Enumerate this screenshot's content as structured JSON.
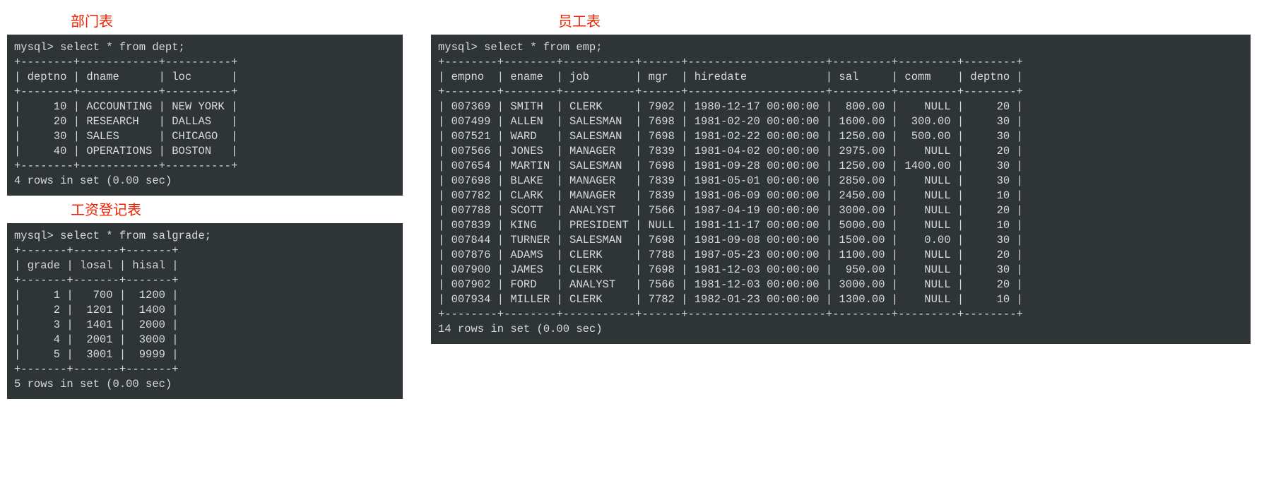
{
  "dept": {
    "caption": "部门表",
    "query": "mysql> select * from dept;",
    "headers": [
      "deptno",
      "dname",
      "loc"
    ],
    "rows": [
      {
        "deptno": "10",
        "dname": "ACCOUNTING",
        "loc": "NEW YORK"
      },
      {
        "deptno": "20",
        "dname": "RESEARCH",
        "loc": "DALLAS"
      },
      {
        "deptno": "30",
        "dname": "SALES",
        "loc": "CHICAGO"
      },
      {
        "deptno": "40",
        "dname": "OPERATIONS",
        "loc": "BOSTON"
      }
    ],
    "summary": "4 rows in set (0.00 sec)"
  },
  "salgrade": {
    "caption": "工资登记表",
    "query": "mysql> select * from salgrade;",
    "headers": [
      "grade",
      "losal",
      "hisal"
    ],
    "rows": [
      {
        "grade": "1",
        "losal": "700",
        "hisal": "1200"
      },
      {
        "grade": "2",
        "losal": "1201",
        "hisal": "1400"
      },
      {
        "grade": "3",
        "losal": "1401",
        "hisal": "2000"
      },
      {
        "grade": "4",
        "losal": "2001",
        "hisal": "3000"
      },
      {
        "grade": "5",
        "losal": "3001",
        "hisal": "9999"
      }
    ],
    "summary": "5 rows in set (0.00 sec)"
  },
  "emp": {
    "caption": "员工表",
    "query": "mysql> select * from emp;",
    "headers": [
      "empno",
      "ename",
      "job",
      "mgr",
      "hiredate",
      "sal",
      "comm",
      "deptno"
    ],
    "rows": [
      {
        "empno": "007369",
        "ename": "SMITH",
        "job": "CLERK",
        "mgr": "7902",
        "hiredate": "1980-12-17 00:00:00",
        "sal": "800.00",
        "comm": "NULL",
        "deptno": "20"
      },
      {
        "empno": "007499",
        "ename": "ALLEN",
        "job": "SALESMAN",
        "mgr": "7698",
        "hiredate": "1981-02-20 00:00:00",
        "sal": "1600.00",
        "comm": "300.00",
        "deptno": "30"
      },
      {
        "empno": "007521",
        "ename": "WARD",
        "job": "SALESMAN",
        "mgr": "7698",
        "hiredate": "1981-02-22 00:00:00",
        "sal": "1250.00",
        "comm": "500.00",
        "deptno": "30"
      },
      {
        "empno": "007566",
        "ename": "JONES",
        "job": "MANAGER",
        "mgr": "7839",
        "hiredate": "1981-04-02 00:00:00",
        "sal": "2975.00",
        "comm": "NULL",
        "deptno": "20"
      },
      {
        "empno": "007654",
        "ename": "MARTIN",
        "job": "SALESMAN",
        "mgr": "7698",
        "hiredate": "1981-09-28 00:00:00",
        "sal": "1250.00",
        "comm": "1400.00",
        "deptno": "30"
      },
      {
        "empno": "007698",
        "ename": "BLAKE",
        "job": "MANAGER",
        "mgr": "7839",
        "hiredate": "1981-05-01 00:00:00",
        "sal": "2850.00",
        "comm": "NULL",
        "deptno": "30"
      },
      {
        "empno": "007782",
        "ename": "CLARK",
        "job": "MANAGER",
        "mgr": "7839",
        "hiredate": "1981-06-09 00:00:00",
        "sal": "2450.00",
        "comm": "NULL",
        "deptno": "10"
      },
      {
        "empno": "007788",
        "ename": "SCOTT",
        "job": "ANALYST",
        "mgr": "7566",
        "hiredate": "1987-04-19 00:00:00",
        "sal": "3000.00",
        "comm": "NULL",
        "deptno": "20"
      },
      {
        "empno": "007839",
        "ename": "KING",
        "job": "PRESIDENT",
        "mgr": "NULL",
        "hiredate": "1981-11-17 00:00:00",
        "sal": "5000.00",
        "comm": "NULL",
        "deptno": "10"
      },
      {
        "empno": "007844",
        "ename": "TURNER",
        "job": "SALESMAN",
        "mgr": "7698",
        "hiredate": "1981-09-08 00:00:00",
        "sal": "1500.00",
        "comm": "0.00",
        "deptno": "30"
      },
      {
        "empno": "007876",
        "ename": "ADAMS",
        "job": "CLERK",
        "mgr": "7788",
        "hiredate": "1987-05-23 00:00:00",
        "sal": "1100.00",
        "comm": "NULL",
        "deptno": "20"
      },
      {
        "empno": "007900",
        "ename": "JAMES",
        "job": "CLERK",
        "mgr": "7698",
        "hiredate": "1981-12-03 00:00:00",
        "sal": "950.00",
        "comm": "NULL",
        "deptno": "30"
      },
      {
        "empno": "007902",
        "ename": "FORD",
        "job": "ANALYST",
        "mgr": "7566",
        "hiredate": "1981-12-03 00:00:00",
        "sal": "3000.00",
        "comm": "NULL",
        "deptno": "20"
      },
      {
        "empno": "007934",
        "ename": "MILLER",
        "job": "CLERK",
        "mgr": "7782",
        "hiredate": "1982-01-23 00:00:00",
        "sal": "1300.00",
        "comm": "NULL",
        "deptno": "10"
      }
    ],
    "summary": "14 rows in set (0.00 sec)"
  }
}
